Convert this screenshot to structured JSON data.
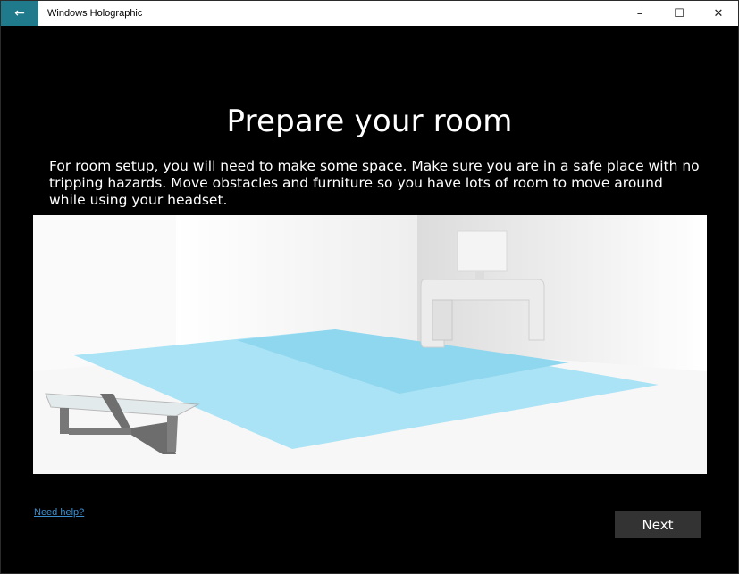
{
  "titlebar": {
    "back_icon": "←",
    "title": "Windows Holographic",
    "minimize_icon": "–",
    "maximize_icon": "☐",
    "close_icon": "✕"
  },
  "main": {
    "heading": "Prepare your room",
    "description": "For room setup, you will need to make some space. Make sure you are in a safe place with no tripping hazards. Move obstacles and furniture so you have lots of room to move around while using your headset.",
    "illustration_icon": "room-illustration"
  },
  "footer": {
    "help_link": "Need help?",
    "next_button": "Next"
  },
  "colors": {
    "accent": "#1f7a8c",
    "floor_area": "#9fdff3",
    "link": "#3a8fd1",
    "button": "#333333"
  }
}
